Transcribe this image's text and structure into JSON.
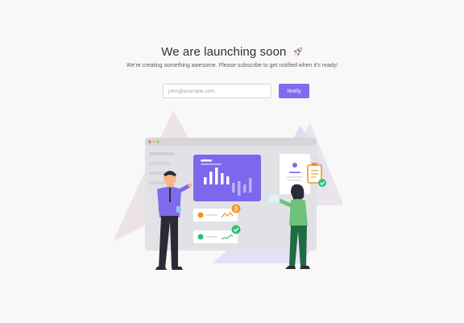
{
  "hero": {
    "title": "We are launching soon",
    "title_icon": "rocket-icon",
    "subtitle": "We're creating something awesome. Please subscribe to get notified when it's ready!"
  },
  "signup": {
    "email_placeholder": "john@example.com",
    "email_value": "",
    "notify_label": "Notify"
  },
  "illustration": {
    "semantic": "team-analytics-dashboard-illustration",
    "icons": [
      "rocket-icon",
      "checkmark-icon",
      "bitcoin-icon",
      "clipboard-icon",
      "user-icon"
    ]
  },
  "colors": {
    "accent": "#7f6bed",
    "background": "#f8f8f9",
    "success": "#2fc07c",
    "warning": "#f7931a",
    "window": "#dcdcdf"
  }
}
